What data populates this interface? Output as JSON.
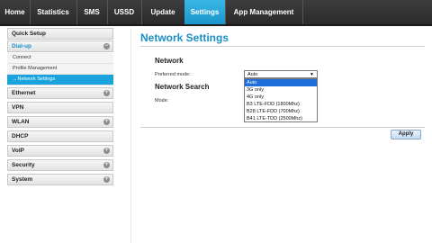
{
  "topnav": {
    "tabs": [
      {
        "label": "Home"
      },
      {
        "label": "Statistics"
      },
      {
        "label": "SMS"
      },
      {
        "label": "USSD"
      },
      {
        "label": "Update"
      },
      {
        "label": "Settings",
        "active": true
      },
      {
        "label": "App Management"
      }
    ]
  },
  "sidebar": {
    "items": [
      {
        "label": "Quick Setup"
      },
      {
        "label": "Dial-up",
        "expand_icon": "minus-icon",
        "children": [
          "Connect",
          "Profile Management",
          "→Network Settings"
        ]
      },
      {
        "label": "Ethernet",
        "expand_icon": "plus-icon"
      },
      {
        "label": "VPN"
      },
      {
        "label": "WLAN",
        "expand_icon": "plus-icon"
      },
      {
        "label": "DHCP"
      },
      {
        "label": "VoIP",
        "expand_icon": "plus-icon"
      },
      {
        "label": "Security",
        "expand_icon": "plus-icon"
      },
      {
        "label": "System",
        "expand_icon": "plus-icon"
      }
    ]
  },
  "main": {
    "title": "Network Settings",
    "network": {
      "heading": "Network",
      "preferred_mode_label": "Preferred mode:",
      "preferred_mode_value": "Auto",
      "options": [
        "Auto",
        "3G only",
        "4G only",
        "B3  LTE-FDD (1800Mhz)",
        "B28 LTE-FDD (700Mhz)",
        "B41 LTE-TDD (2500Mhz)"
      ]
    },
    "network_search": {
      "heading": "Network Search",
      "mode_label": "Mode:"
    },
    "apply_label": "Apply"
  },
  "colors": {
    "accent": "#1aa3dc",
    "title": "#1c8fc4",
    "nav_bg": "#333333",
    "dropdown_highlight": "#1e6fd9"
  }
}
